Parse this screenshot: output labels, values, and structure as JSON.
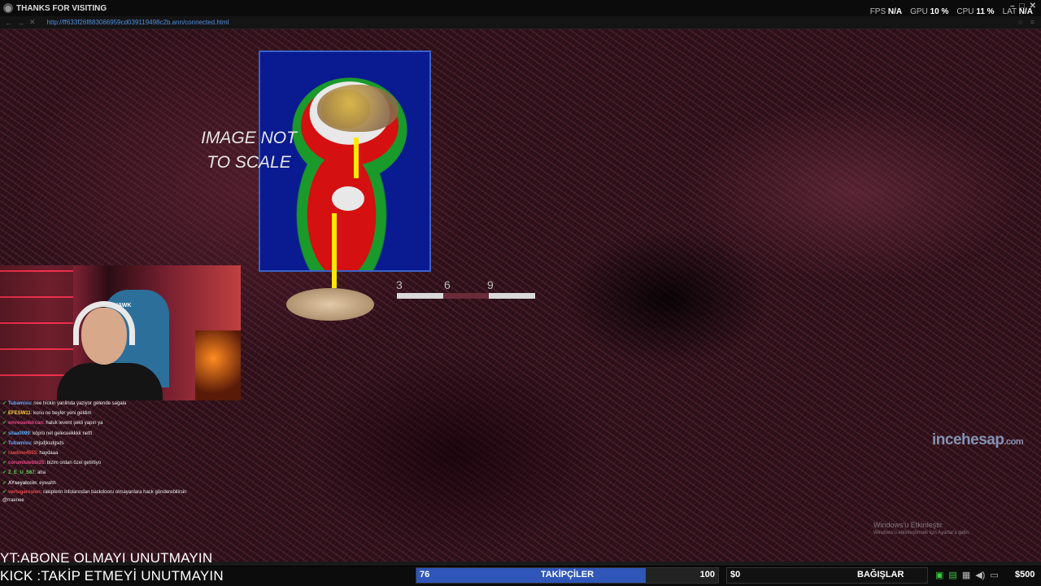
{
  "window": {
    "title": "THANKS FOR VISITING",
    "app_icon": "browser-globe-icon",
    "url": "http://ff633f26f883066959cd039119498c2b.ann/connected.html"
  },
  "stats": {
    "fps_label": "FPS",
    "fps_value": "N/A",
    "gpu_label": "GPU",
    "gpu_value": "10 %",
    "cpu_label": "CPU",
    "cpu_value": "11 %",
    "lat_label": "LAT",
    "lat_value": "N/A"
  },
  "scene": {
    "caption_line1": "IMAGE NOT",
    "caption_line2": "TO SCALE",
    "scale_labels": [
      "3",
      "6",
      "9"
    ]
  },
  "webcam": {
    "chair_logo": "HAWK"
  },
  "chat": [
    {
      "user": "Tubamisu",
      "text": "nee hickin yanlinda yaziyor gelende sagala",
      "color": "#6fa8ff"
    },
    {
      "user": "EFESW11",
      "text": "konu ne beyler yeni geldim",
      "color": "#ffd23f"
    },
    {
      "user": "emreoanbircan",
      "text": "haluk levent şekli yapın ya",
      "color": "#e84a8a"
    },
    {
      "user": "silaa0099",
      "text": "köprü net geleceekkkk nettt",
      "color": "#5ab0ff"
    },
    {
      "user": "Tubamisu",
      "text": "shjsdjksdgsds",
      "color": "#6fa8ff"
    },
    {
      "user": "raedmo4555",
      "text": "haydaaa",
      "color": "#e84a4a"
    },
    {
      "user": "corumlulebbi25",
      "text": "bizim ordan özel getirtiyo",
      "color": "#e84a8a"
    },
    {
      "user": "Z_E_U_S67",
      "text": "aha",
      "color": "#5ad65a"
    },
    {
      "user": "AYseyalccin",
      "text": "eywahh",
      "color": "#dddddd"
    },
    {
      "user": "vertugaroslen",
      "text": "rakiplerin infolarından backdooru olmayanlara hack gönderebilirsin @rraenee",
      "color": "#e84a4a"
    }
  ],
  "watermarks": {
    "brand_main": "incehesap",
    "brand_suffix": ".com",
    "activate_title": "Windows'u Etkinleştir",
    "activate_sub": "Windows'u etkinleştirmek için Ayarlar'a gidin."
  },
  "ticker": {
    "line1": "YT:ABONE OLMAYI UNUTMAYIN",
    "line2": "KICK :TAKİP ETMEYİ UNUTMAYIN"
  },
  "followers": {
    "current": "76",
    "label": "TAKİPÇİLER",
    "goal": "100",
    "progress": 0.76
  },
  "donations": {
    "current": "$0",
    "label": "BAĞIŞLAR",
    "goal": "$500"
  },
  "colors": {
    "follow_bar": "#2f56b8",
    "scene_base": "#2a0f18",
    "thermal_border": "#3a62c8",
    "probe_line": "#ffe800"
  }
}
